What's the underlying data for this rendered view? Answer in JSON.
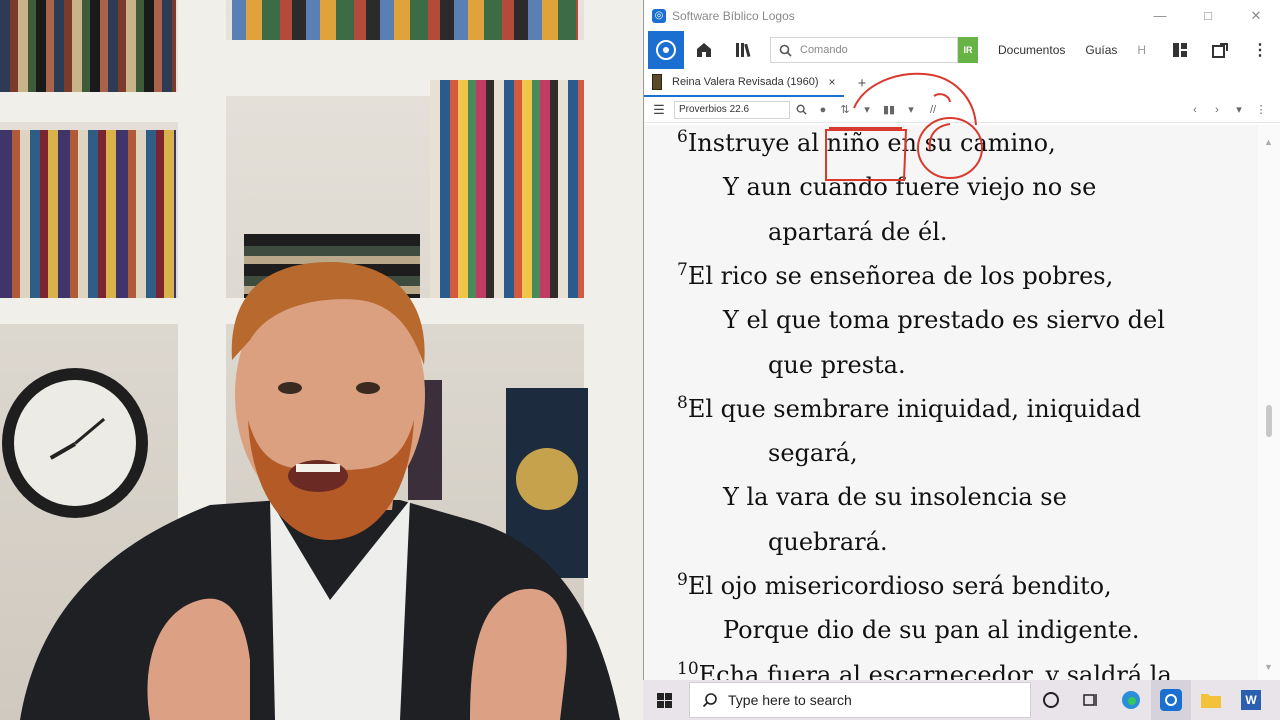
{
  "app": {
    "window_title": "Software Bíblico Logos",
    "window_controls": [
      "minimize-icon",
      "maximize-icon",
      "close-icon"
    ]
  },
  "toolbar": {
    "command_placeholder": "Comando",
    "ir_label": "IR",
    "menu": [
      "Documentos",
      "Guías",
      "H"
    ],
    "icons": [
      "home-icon",
      "library-icon",
      "layout-icon",
      "open-window-icon",
      "more-icon"
    ]
  },
  "tab": {
    "label": "Reina Valera Revisada (1960)",
    "close": "×",
    "add": "+"
  },
  "panel": {
    "reference": "Proverbios 22.6"
  },
  "verses": {
    "v6": {
      "num": "6",
      "l1": "Instruye al niño en su camino,",
      "l2": "Y aun cuando fuere viejo no se",
      "l3": "apartará de él."
    },
    "v7": {
      "num": "7",
      "l1": "El rico se enseñorea de los pobres,",
      "l2": "Y el que toma prestado es siervo del",
      "l3": "que presta."
    },
    "v8": {
      "num": "8",
      "l1": "El que sembrare iniquidad, iniquidad",
      "l2": "segará,",
      "l3": "Y la vara de su insolencia se",
      "l4": "quebrará."
    },
    "v9": {
      "num": "9",
      "l1": "El ojo misericordioso será bendito,",
      "l2": "Porque dio de su pan al indigente."
    },
    "v10": {
      "num": "10",
      "l1": "Echa fuera al escarnecedor, y saldrá la"
    }
  },
  "taskbar": {
    "search_placeholder": "Type here to search",
    "icons": [
      "windows-start-icon",
      "search-icon",
      "cortana-icon",
      "task-view-icon",
      "edge-icon",
      "logos-icon",
      "file-explorer-icon",
      "word-icon"
    ]
  },
  "colors": {
    "accent": "#1a6fd1",
    "ir_green": "#67b346",
    "ink_red": "#d83a2e"
  }
}
